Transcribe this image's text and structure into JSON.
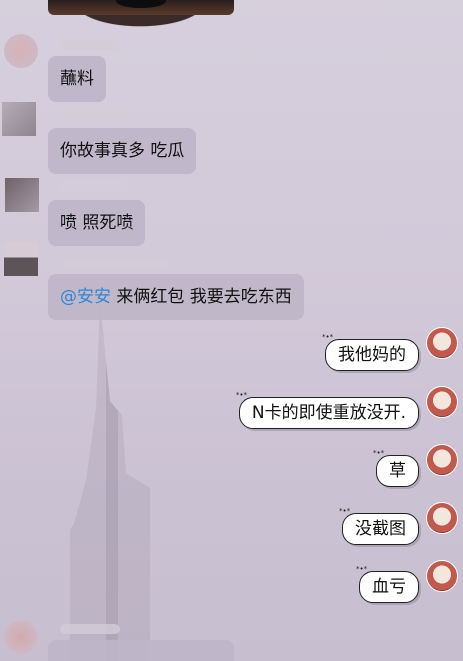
{
  "incoming": [
    {
      "text": "蘸料"
    },
    {
      "text": "你故事真多   吃瓜"
    },
    {
      "text": "喷  照死喷"
    },
    {
      "mention": "@安安",
      "text": " 来俩红包    我要去吃东西"
    }
  ],
  "outgoing": [
    {
      "text": "我他妈的"
    },
    {
      "text": "N卡的即使重放没开."
    },
    {
      "text": "草"
    },
    {
      "text": "没截图"
    },
    {
      "text": "血亏"
    }
  ],
  "bubble_deco": "*•*",
  "colors": {
    "mention": "#2f86d8",
    "incoming_bubble": "#bdb6c8",
    "outgoing_bubble": "#ffffff"
  }
}
